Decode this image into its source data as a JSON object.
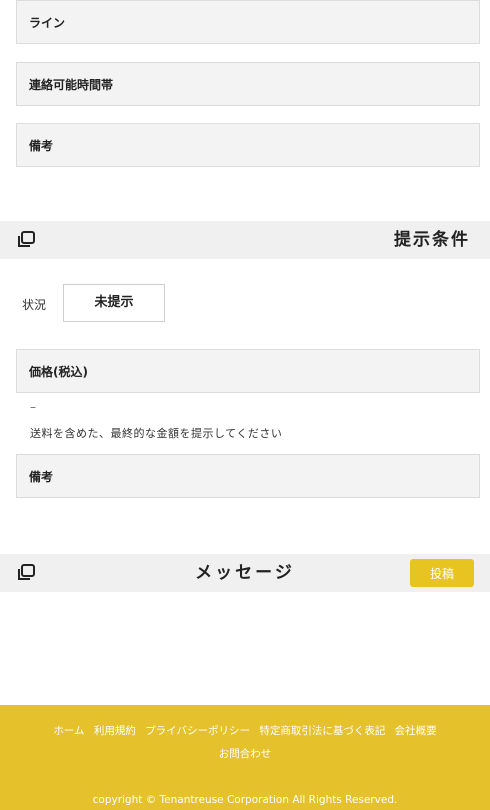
{
  "contact_fields": {
    "line": "ライン",
    "available_hours": "連絡可能時間帯",
    "remarks": "備考"
  },
  "offer_section": {
    "title": "提示条件",
    "icon": "copy-icon",
    "status_label": "状況",
    "status_value": "未提示",
    "price_label": "価格(税込)",
    "price_value": "–",
    "price_hint": "送料を含めた、最終的な金額を提示してください",
    "remarks_label": "備考"
  },
  "message_section": {
    "title": "メッセージ",
    "icon": "copy-icon",
    "post_button": "投稿"
  },
  "footer": {
    "links": [
      "ホーム",
      "利用規約",
      "プライバシーポリシー",
      "特定商取引法に基づく表記",
      "会社概要"
    ],
    "contact": "お問合わせ",
    "copyright": "copyright © Tenantreuse Corporation All Rights Reserved."
  },
  "colors": {
    "accent": "#e5c12c",
    "button": "#e7c41f",
    "field_bg": "#f3f3f3",
    "section_bg": "#f0f0f0"
  }
}
